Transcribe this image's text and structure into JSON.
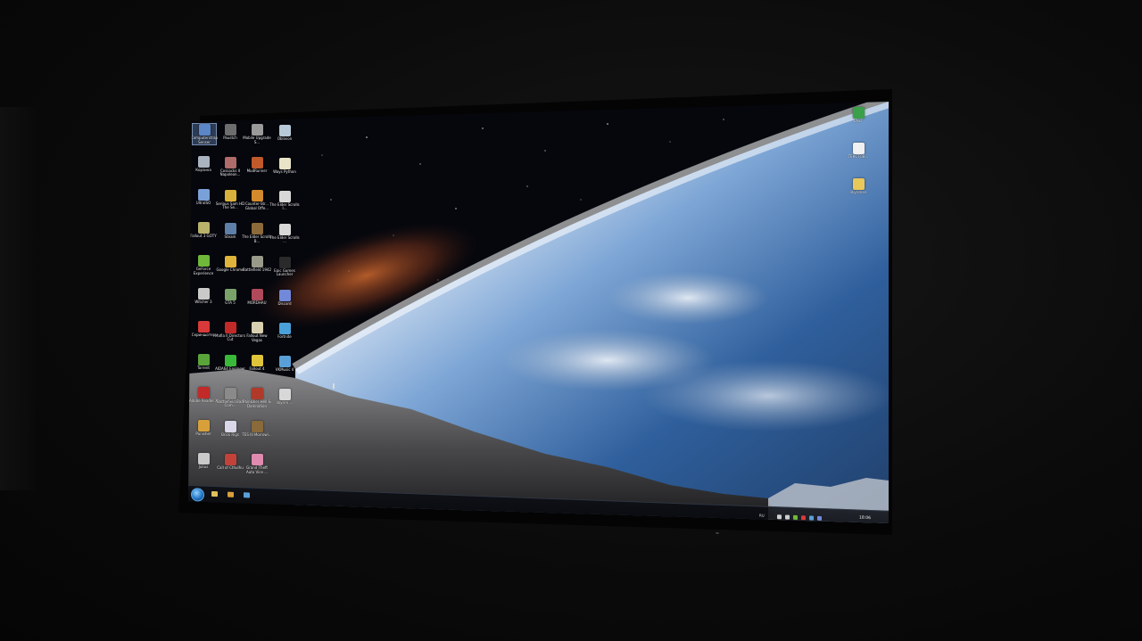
{
  "colors": {
    "room": "#0b0b0b",
    "space": "#07080e",
    "nebula": "#c8602a",
    "planet_glow": "#f4f8ff",
    "ocean": "#2a5d9a",
    "moon_surface": "#5a5a5c"
  },
  "desktop_icons": [
    {
      "label": "Computerstrap Senser",
      "icon": "computer-icon",
      "color": "#5b86c7",
      "col": 0,
      "row": 0,
      "selected": true
    },
    {
      "label": "Paustch",
      "icon": "game-icon",
      "color": "#6d6d6d",
      "col": 1,
      "row": 0
    },
    {
      "label": "Mobile Upgrade S...",
      "icon": "gear-icon",
      "color": "#9a9a9a",
      "col": 2,
      "row": 0
    },
    {
      "label": "Oblivion",
      "icon": "game-icon",
      "color": "#b7c9d8",
      "col": 3,
      "row": 0
    },
    {
      "label": "Корзина",
      "icon": "recycle-bin-icon",
      "color": "#aab3c0",
      "col": 0,
      "row": 1
    },
    {
      "label": "Cossacks II Napoleon...",
      "icon": "game-icon",
      "color": "#b06b6b",
      "col": 1,
      "row": 1
    },
    {
      "label": "MudRunner",
      "icon": "game-icon",
      "color": "#c05a2a",
      "col": 2,
      "row": 1
    },
    {
      "label": "Ways Python",
      "icon": "folder-icon",
      "color": "#e9e3c8",
      "col": 3,
      "row": 1
    },
    {
      "label": "UltraISO",
      "icon": "disc-icon",
      "color": "#7aa0d8",
      "col": 0,
      "row": 2
    },
    {
      "label": "Serious Sam HD The Se...",
      "icon": "game-icon",
      "color": "#d9b13a",
      "col": 1,
      "row": 2
    },
    {
      "label": "Counter-Str... Global Offe...",
      "icon": "game-icon",
      "color": "#d38a2c",
      "col": 2,
      "row": 2
    },
    {
      "label": "The Elder Scrolls I...",
      "icon": "game-icon",
      "color": "#d8d8d8",
      "col": 3,
      "row": 2
    },
    {
      "label": "Fallout 3 GOTY",
      "icon": "game-icon",
      "color": "#b8b26a",
      "col": 0,
      "row": 3
    },
    {
      "label": "Steam",
      "icon": "steam-icon",
      "color": "#5e7fa8",
      "col": 1,
      "row": 3
    },
    {
      "label": "The Elder Scrolls B...",
      "icon": "game-icon",
      "color": "#8c6a3a",
      "col": 2,
      "row": 3
    },
    {
      "label": "The Elder Scrolls ...",
      "icon": "game-icon",
      "color": "#d8d8d8",
      "col": 3,
      "row": 3
    },
    {
      "label": "GeForce Experience",
      "icon": "nvidia-icon",
      "color": "#6fb83a",
      "col": 0,
      "row": 4
    },
    {
      "label": "Google Chrome",
      "icon": "chrome-icon",
      "color": "#e0b43a",
      "col": 1,
      "row": 4
    },
    {
      "label": "Battlefield 1942",
      "icon": "game-icon",
      "color": "#9a9a8a",
      "col": 2,
      "row": 4
    },
    {
      "label": "Epic Games Launcher",
      "icon": "epic-icon",
      "color": "#2a2a2a",
      "col": 3,
      "row": 4
    },
    {
      "label": "Witcher 3",
      "icon": "game-icon",
      "color": "#c9c9c9",
      "col": 0,
      "row": 5
    },
    {
      "label": "GTA 5",
      "icon": "game-icon",
      "color": "#7aa36a",
      "col": 1,
      "row": 5
    },
    {
      "label": "MORDHAU",
      "icon": "game-icon",
      "color": "#b04a5a",
      "col": 2,
      "row": 5
    },
    {
      "label": "Discord",
      "icon": "discord-icon",
      "color": "#7289da",
      "col": 3,
      "row": 5
    },
    {
      "label": "Скриншотер",
      "icon": "screenshot-icon",
      "color": "#d83a3a",
      "col": 0,
      "row": 6
    },
    {
      "label": "Mafia II Directors Cut",
      "icon": "game-icon",
      "color": "#c22a2a",
      "col": 1,
      "row": 6
    },
    {
      "label": "Fallout New Vegas",
      "icon": "game-icon",
      "color": "#d8d0b0",
      "col": 2,
      "row": 6
    },
    {
      "label": "Fortnite",
      "icon": "game-icon",
      "color": "#4aa0d8",
      "col": 3,
      "row": 6
    },
    {
      "label": "Torrent",
      "icon": "torrent-icon",
      "color": "#5aa53a",
      "col": 0,
      "row": 7
    },
    {
      "label": "AIDA64 Engineer",
      "icon": "aida64-icon",
      "color": "#3ab83a",
      "col": 1,
      "row": 7
    },
    {
      "label": "Fallout 4",
      "icon": "game-icon",
      "color": "#e0c53a",
      "col": 2,
      "row": 7
    },
    {
      "label": "VKMusic 4",
      "icon": "music-icon",
      "color": "#5aa0d8",
      "col": 3,
      "row": 7
    },
    {
      "label": "Adobe Reader X",
      "icon": "pdf-icon",
      "color": "#c22a2a",
      "col": 0,
      "row": 8
    },
    {
      "label": "Battlefield Bad Com...",
      "icon": "game-icon",
      "color": "#8a8a8a",
      "col": 1,
      "row": 8
    },
    {
      "label": "Painkiller Hell & Damnation",
      "icon": "game-icon",
      "color": "#b03a2a",
      "col": 2,
      "row": 8
    },
    {
      "label": "skyrim ...",
      "icon": "folder-icon",
      "color": "#d8d8d8",
      "col": 3,
      "row": 8
    },
    {
      "label": "Punisher",
      "icon": "game-icon",
      "color": "#d8a03a",
      "col": 0,
      "row": 9
    },
    {
      "label": "Brick Rigs",
      "icon": "game-icon",
      "color": "#d8d8e8",
      "col": 1,
      "row": 9
    },
    {
      "label": "TES III Morrowi...",
      "icon": "game-icon",
      "color": "#8a6a3a",
      "col": 2,
      "row": 9
    },
    {
      "label": "Julius",
      "icon": "game-icon",
      "color": "#c9c9c9",
      "col": 0,
      "row": 10
    },
    {
      "label": "Call of Cthulhu",
      "icon": "game-icon",
      "color": "#c2423a",
      "col": 1,
      "row": 10
    },
    {
      "label": "Grand Theft Auto Vice ...",
      "icon": "game-icon",
      "color": "#e08ab0",
      "col": 2,
      "row": 10
    }
  ],
  "right_icons": [
    {
      "label": "LAST",
      "icon": "app-icon",
      "color": "#3aa04a"
    },
    {
      "label": "ТЕКСТОВ...",
      "icon": "document-icon",
      "color": "#f0f0f0"
    },
    {
      "label": "skyrimse",
      "icon": "folder-icon",
      "color": "#e8c85a"
    }
  ],
  "taskbar": {
    "pinned": [
      {
        "icon": "explorer-icon",
        "color": "#e0c05a"
      },
      {
        "icon": "chrome-icon",
        "color": "#d8a03a"
      },
      {
        "icon": "steam-icon",
        "color": "#5aa0d8"
      }
    ],
    "tray": {
      "language": "RU",
      "clock": "18:06",
      "icons": [
        {
          "icon": "network-icon",
          "color": "#cfcfcf"
        },
        {
          "icon": "volume-icon",
          "color": "#cfcfcf"
        },
        {
          "icon": "nvidia-icon",
          "color": "#6fb83a"
        },
        {
          "icon": "antivirus-icon",
          "color": "#d83a3a"
        },
        {
          "icon": "steam-icon",
          "color": "#5aa0d8"
        },
        {
          "icon": "discord-icon",
          "color": "#7289da"
        }
      ]
    }
  }
}
